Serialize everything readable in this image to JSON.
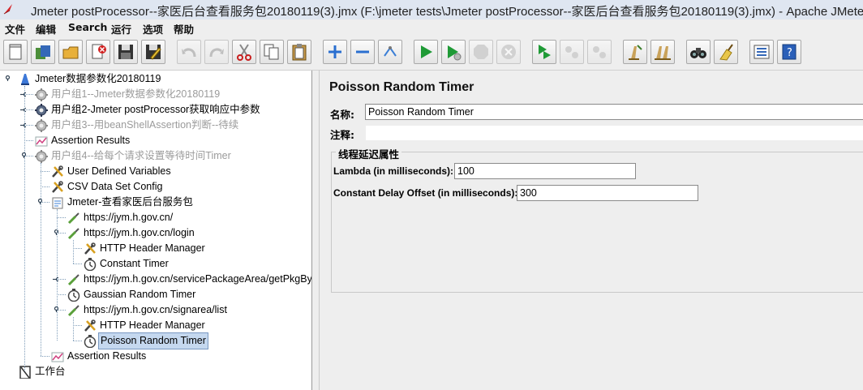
{
  "window": {
    "title": "Jmeter postProcessor--家医后台查看服务包20180119(3).jmx (F:\\jmeter tests\\Jmeter postProcessor--家医后台查看服务包20180119(3).jmx) - Apache JMeter"
  },
  "menu": [
    "文件",
    "编辑",
    "Search",
    "运行",
    "选项",
    "帮助"
  ],
  "toolbar": [
    {
      "name": "new-icon",
      "enabled": true
    },
    {
      "name": "templates-icon",
      "enabled": true
    },
    {
      "name": "open-icon",
      "enabled": true
    },
    {
      "name": "close-icon",
      "enabled": true
    },
    {
      "name": "save-icon",
      "enabled": true
    },
    {
      "name": "save-as-icon",
      "enabled": true
    },
    {
      "name": "undo-icon",
      "enabled": false
    },
    {
      "name": "redo-icon",
      "enabled": false
    },
    {
      "name": "cut-icon",
      "enabled": true
    },
    {
      "name": "copy-icon",
      "enabled": true
    },
    {
      "name": "paste-icon",
      "enabled": true
    },
    {
      "name": "expand-icon",
      "enabled": true
    },
    {
      "name": "collapse-icon",
      "enabled": true
    },
    {
      "name": "toggle-icon",
      "enabled": true
    },
    {
      "name": "start-icon",
      "enabled": true
    },
    {
      "name": "start-no-pause-icon",
      "enabled": true
    },
    {
      "name": "stop-icon",
      "enabled": false
    },
    {
      "name": "shutdown-icon",
      "enabled": false
    },
    {
      "name": "remote-start-icon",
      "enabled": true
    },
    {
      "name": "remote-stop-icon",
      "enabled": false
    },
    {
      "name": "remote-shutdown-icon",
      "enabled": false
    },
    {
      "name": "clear-icon",
      "enabled": true
    },
    {
      "name": "clear-all-icon",
      "enabled": true
    },
    {
      "name": "search-icon",
      "enabled": true
    },
    {
      "name": "reset-search-icon",
      "enabled": true
    },
    {
      "name": "function-helper-icon",
      "enabled": true
    },
    {
      "name": "help-icon",
      "enabled": true
    }
  ],
  "tree": [
    {
      "label": "Jmeter数据参数化20180119",
      "icon": "test-plan-icon",
      "depth": 0,
      "disabled": false,
      "selected": false,
      "handle": "expanded"
    },
    {
      "label": "用户组1--Jmeter数据参数化20180119",
      "icon": "thread-group-icon",
      "depth": 1,
      "disabled": true,
      "selected": false,
      "handle": "collapsed"
    },
    {
      "label": "用户组2-Jmeter postProcessor获取响应中参数",
      "icon": "thread-group-icon",
      "depth": 1,
      "disabled": false,
      "selected": false,
      "handle": "collapsed"
    },
    {
      "label": "用户组3--用beanShellAssertion判断--待续",
      "icon": "thread-group-icon",
      "depth": 1,
      "disabled": true,
      "selected": false,
      "handle": "collapsed"
    },
    {
      "label": "Assertion Results",
      "icon": "assertion-results-icon",
      "depth": 1,
      "disabled": false,
      "selected": false,
      "handle": "none"
    },
    {
      "label": "用户组4--给每个请求设置等待时间Timer",
      "icon": "thread-group-icon",
      "depth": 1,
      "disabled": true,
      "selected": false,
      "handle": "expanded"
    },
    {
      "label": "User Defined Variables",
      "icon": "config-icon",
      "depth": 2,
      "disabled": false,
      "selected": false,
      "handle": "none"
    },
    {
      "label": "CSV Data Set Config",
      "icon": "config-icon",
      "depth": 2,
      "disabled": false,
      "selected": false,
      "handle": "none"
    },
    {
      "label": "Jmeter-查看家医后台服务包",
      "icon": "transaction-controller-icon",
      "depth": 2,
      "disabled": false,
      "selected": false,
      "handle": "expanded"
    },
    {
      "label": "https://jym.h.gov.cn/",
      "icon": "sampler-icon",
      "depth": 3,
      "disabled": false,
      "selected": false,
      "handle": "none"
    },
    {
      "label": "https://jym.h.gov.cn/login",
      "icon": "sampler-icon",
      "depth": 3,
      "disabled": false,
      "selected": false,
      "handle": "expanded"
    },
    {
      "label": "HTTP Header Manager",
      "icon": "config-icon",
      "depth": 4,
      "disabled": false,
      "selected": false,
      "handle": "none"
    },
    {
      "label": "Constant Timer",
      "icon": "timer-icon",
      "depth": 4,
      "disabled": false,
      "selected": false,
      "handle": "none"
    },
    {
      "label": "https://jym.h.gov.cn/servicePackageArea/getPkgBylo",
      "icon": "sampler-icon",
      "depth": 3,
      "disabled": false,
      "selected": false,
      "handle": "collapsed"
    },
    {
      "label": "Gaussian Random Timer",
      "icon": "timer-icon",
      "depth": 3,
      "disabled": false,
      "selected": false,
      "handle": "none"
    },
    {
      "label": "https://jym.h.gov.cn/signarea/list",
      "icon": "sampler-icon",
      "depth": 3,
      "disabled": false,
      "selected": false,
      "handle": "expanded"
    },
    {
      "label": "HTTP Header Manager",
      "icon": "config-icon",
      "depth": 4,
      "disabled": false,
      "selected": false,
      "handle": "none"
    },
    {
      "label": "Poisson Random Timer",
      "icon": "timer-icon",
      "depth": 4,
      "disabled": false,
      "selected": true,
      "handle": "none"
    },
    {
      "label": "Assertion Results",
      "icon": "assertion-results-icon",
      "depth": 2,
      "disabled": false,
      "selected": false,
      "handle": "none"
    },
    {
      "label": "工作台",
      "icon": "workbench-icon",
      "depth": 0,
      "disabled": false,
      "selected": false,
      "handle": "none"
    }
  ],
  "panel": {
    "title": "Poisson Random Timer",
    "name_label": "名称:",
    "name_value": "Poisson Random Timer",
    "comments_label": "注释:",
    "comments_value": "",
    "group_title": "线程延迟属性",
    "lambda_label": "Lambda (in milliseconds):",
    "lambda_value": "100",
    "offset_label": "Constant Delay Offset (in milliseconds):",
    "offset_value": "300"
  }
}
